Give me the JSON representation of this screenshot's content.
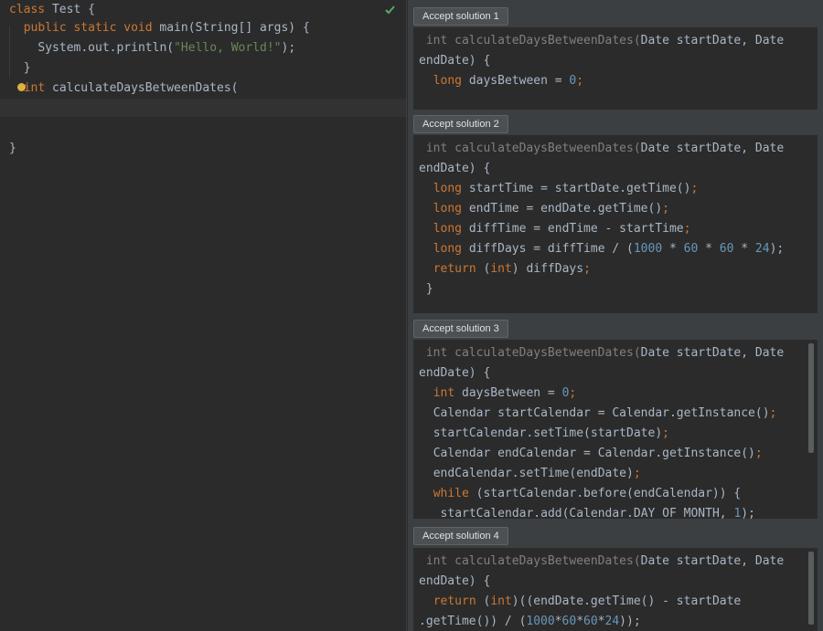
{
  "editor": {
    "lines": [
      {
        "indent": 0,
        "parts": [
          {
            "t": "class",
            "c": "kw"
          },
          {
            "t": " Test {",
            "c": ""
          }
        ]
      },
      {
        "indent": 2,
        "parts": [
          {
            "t": "public static void",
            "c": "kw"
          },
          {
            "t": " main(String[] args) {",
            "c": ""
          }
        ]
      },
      {
        "indent": 4,
        "parts": [
          {
            "t": "System.out.println(",
            "c": ""
          },
          {
            "t": "\"Hello, World!\"",
            "c": "str"
          },
          {
            "t": ");",
            "c": ""
          }
        ]
      },
      {
        "indent": 2,
        "parts": [
          {
            "t": "}",
            "c": ""
          }
        ]
      },
      {
        "indent": 2,
        "parts": [
          {
            "t": "int",
            "c": "kw"
          },
          {
            "t": " calculateDaysBetweenDates(",
            "c": ""
          }
        ]
      },
      {
        "indent": 0,
        "parts": []
      },
      {
        "indent": 0,
        "parts": []
      },
      {
        "indent": 0,
        "parts": [
          {
            "t": "}",
            "c": ""
          }
        ]
      }
    ]
  },
  "solutions": [
    {
      "button": "Accept solution 1",
      "lines": [
        {
          "indent": 1,
          "parts": [
            {
              "t": "int calculateDaysBetweenDates(",
              "c": "muted"
            },
            {
              "t": "Date startDate, Date",
              "c": ""
            }
          ]
        },
        {
          "indent": 0,
          "parts": [
            {
              "t": "endDate) {",
              "c": ""
            }
          ]
        },
        {
          "indent": 2,
          "parts": [
            {
              "t": "long",
              "c": "kw"
            },
            {
              "t": " daysBetween = ",
              "c": ""
            },
            {
              "t": "0",
              "c": "num"
            },
            {
              "t": ";",
              "c": "kw"
            }
          ]
        }
      ]
    },
    {
      "button": "Accept solution 2",
      "lines": [
        {
          "indent": 1,
          "parts": [
            {
              "t": "int calculateDaysBetweenDates(",
              "c": "muted"
            },
            {
              "t": "Date startDate, Date",
              "c": ""
            }
          ]
        },
        {
          "indent": 0,
          "parts": [
            {
              "t": "endDate) {",
              "c": ""
            }
          ]
        },
        {
          "indent": 2,
          "parts": [
            {
              "t": "long",
              "c": "kw"
            },
            {
              "t": " startTime = startDate.getTime()",
              "c": ""
            },
            {
              "t": ";",
              "c": "kw"
            }
          ]
        },
        {
          "indent": 2,
          "parts": [
            {
              "t": "long",
              "c": "kw"
            },
            {
              "t": " endTime = endDate.getTime()",
              "c": ""
            },
            {
              "t": ";",
              "c": "kw"
            }
          ]
        },
        {
          "indent": 2,
          "parts": [
            {
              "t": "long",
              "c": "kw"
            },
            {
              "t": " diffTime = endTime - startTime",
              "c": ""
            },
            {
              "t": ";",
              "c": "kw"
            }
          ]
        },
        {
          "indent": 2,
          "parts": [
            {
              "t": "long",
              "c": "kw"
            },
            {
              "t": " diffDays = diffTime / (",
              "c": ""
            },
            {
              "t": "1000",
              "c": "num"
            },
            {
              "t": " * ",
              "c": ""
            },
            {
              "t": "60",
              "c": "num"
            },
            {
              "t": " * ",
              "c": ""
            },
            {
              "t": "60",
              "c": "num"
            },
            {
              "t": " * ",
              "c": ""
            },
            {
              "t": "24",
              "c": "num"
            },
            {
              "t": ");",
              "c": ""
            }
          ]
        },
        {
          "indent": 2,
          "parts": [
            {
              "t": "return",
              "c": "kw"
            },
            {
              "t": " (",
              "c": ""
            },
            {
              "t": "int",
              "c": "kw"
            },
            {
              "t": ") diffDays",
              "c": ""
            },
            {
              "t": ";",
              "c": "kw"
            }
          ]
        },
        {
          "indent": 1,
          "parts": [
            {
              "t": "}",
              "c": ""
            }
          ]
        }
      ]
    },
    {
      "button": "Accept solution 3",
      "lines": [
        {
          "indent": 1,
          "parts": [
            {
              "t": "int calculateDaysBetweenDates(",
              "c": "muted"
            },
            {
              "t": "Date startDate, Date",
              "c": ""
            }
          ]
        },
        {
          "indent": 0,
          "parts": [
            {
              "t": "endDate) {",
              "c": ""
            }
          ]
        },
        {
          "indent": 2,
          "parts": [
            {
              "t": "int",
              "c": "kw"
            },
            {
              "t": " daysBetween = ",
              "c": ""
            },
            {
              "t": "0",
              "c": "num"
            },
            {
              "t": ";",
              "c": "kw"
            }
          ]
        },
        {
          "indent": 2,
          "parts": [
            {
              "t": "Calendar startCalendar = Calendar.getInstance()",
              "c": ""
            },
            {
              "t": ";",
              "c": "kw"
            }
          ]
        },
        {
          "indent": 2,
          "parts": [
            {
              "t": "startCalendar.setTime(startDate)",
              "c": ""
            },
            {
              "t": ";",
              "c": "kw"
            }
          ]
        },
        {
          "indent": 2,
          "parts": [
            {
              "t": "Calendar endCalendar = Calendar.getInstance()",
              "c": ""
            },
            {
              "t": ";",
              "c": "kw"
            }
          ]
        },
        {
          "indent": 2,
          "parts": [
            {
              "t": "endCalendar.setTime(endDate)",
              "c": ""
            },
            {
              "t": ";",
              "c": "kw"
            }
          ]
        },
        {
          "indent": 2,
          "parts": [
            {
              "t": "while",
              "c": "kw"
            },
            {
              "t": " (startCalendar.before(endCalendar)) {",
              "c": ""
            }
          ]
        },
        {
          "indent": 3,
          "parts": [
            {
              "t": "startCalendar.add(Calendar.DAY_OF_MONTH, ",
              "c": ""
            },
            {
              "t": "1",
              "c": "num"
            },
            {
              "t": ");",
              "c": ""
            }
          ]
        }
      ]
    },
    {
      "button": "Accept solution 4",
      "lines": [
        {
          "indent": 1,
          "parts": [
            {
              "t": "int calculateDaysBetweenDates(",
              "c": "muted"
            },
            {
              "t": "Date startDate, Date",
              "c": ""
            }
          ]
        },
        {
          "indent": 0,
          "parts": [
            {
              "t": "endDate) {",
              "c": ""
            }
          ]
        },
        {
          "indent": 2,
          "parts": [
            {
              "t": "return",
              "c": "kw"
            },
            {
              "t": " (",
              "c": ""
            },
            {
              "t": "int",
              "c": "kw"
            },
            {
              "t": ")((endDate.getTime() - startDate",
              "c": ""
            }
          ]
        },
        {
          "indent": 0,
          "parts": [
            {
              "t": ".getTime()) / (",
              "c": ""
            },
            {
              "t": "1000",
              "c": "num"
            },
            {
              "t": "*",
              "c": ""
            },
            {
              "t": "60",
              "c": "num"
            },
            {
              "t": "*",
              "c": ""
            },
            {
              "t": "60",
              "c": "num"
            },
            {
              "t": "*",
              "c": ""
            },
            {
              "t": "24",
              "c": "num"
            },
            {
              "t": "));",
              "c": ""
            }
          ]
        }
      ]
    }
  ]
}
